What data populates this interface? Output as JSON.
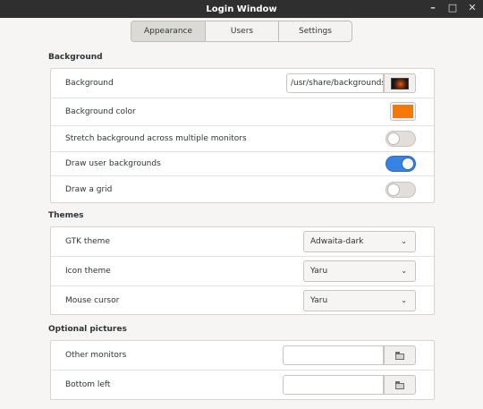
{
  "window": {
    "title": "Login Window"
  },
  "tabs": [
    {
      "label": "Appearance",
      "active": true
    },
    {
      "label": "Users",
      "active": false
    },
    {
      "label": "Settings",
      "active": false
    }
  ],
  "background_section": {
    "title": "Background",
    "background": {
      "label": "Background",
      "path": "/usr/share/backgrounds/c"
    },
    "background_color": {
      "label": "Background color",
      "color": "#f57900"
    },
    "stretch": {
      "label": "Stretch background across multiple monitors",
      "on": false
    },
    "user_backgrounds": {
      "label": "Draw user backgrounds",
      "on": true
    },
    "grid": {
      "label": "Draw a grid",
      "on": false
    }
  },
  "themes_section": {
    "title": "Themes",
    "gtk_theme": {
      "label": "GTK theme",
      "value": "Adwaita-dark"
    },
    "icon_theme": {
      "label": "Icon theme",
      "value": "Yaru"
    },
    "mouse_cursor": {
      "label": "Mouse cursor",
      "value": "Yaru"
    }
  },
  "pictures_section": {
    "title": "Optional pictures",
    "other_monitors": {
      "label": "Other monitors",
      "value": ""
    },
    "bottom_left": {
      "label": "Bottom left",
      "value": ""
    }
  },
  "colors": {
    "switch_on": "#3584e4",
    "titlebar": "#2f2f2f"
  }
}
